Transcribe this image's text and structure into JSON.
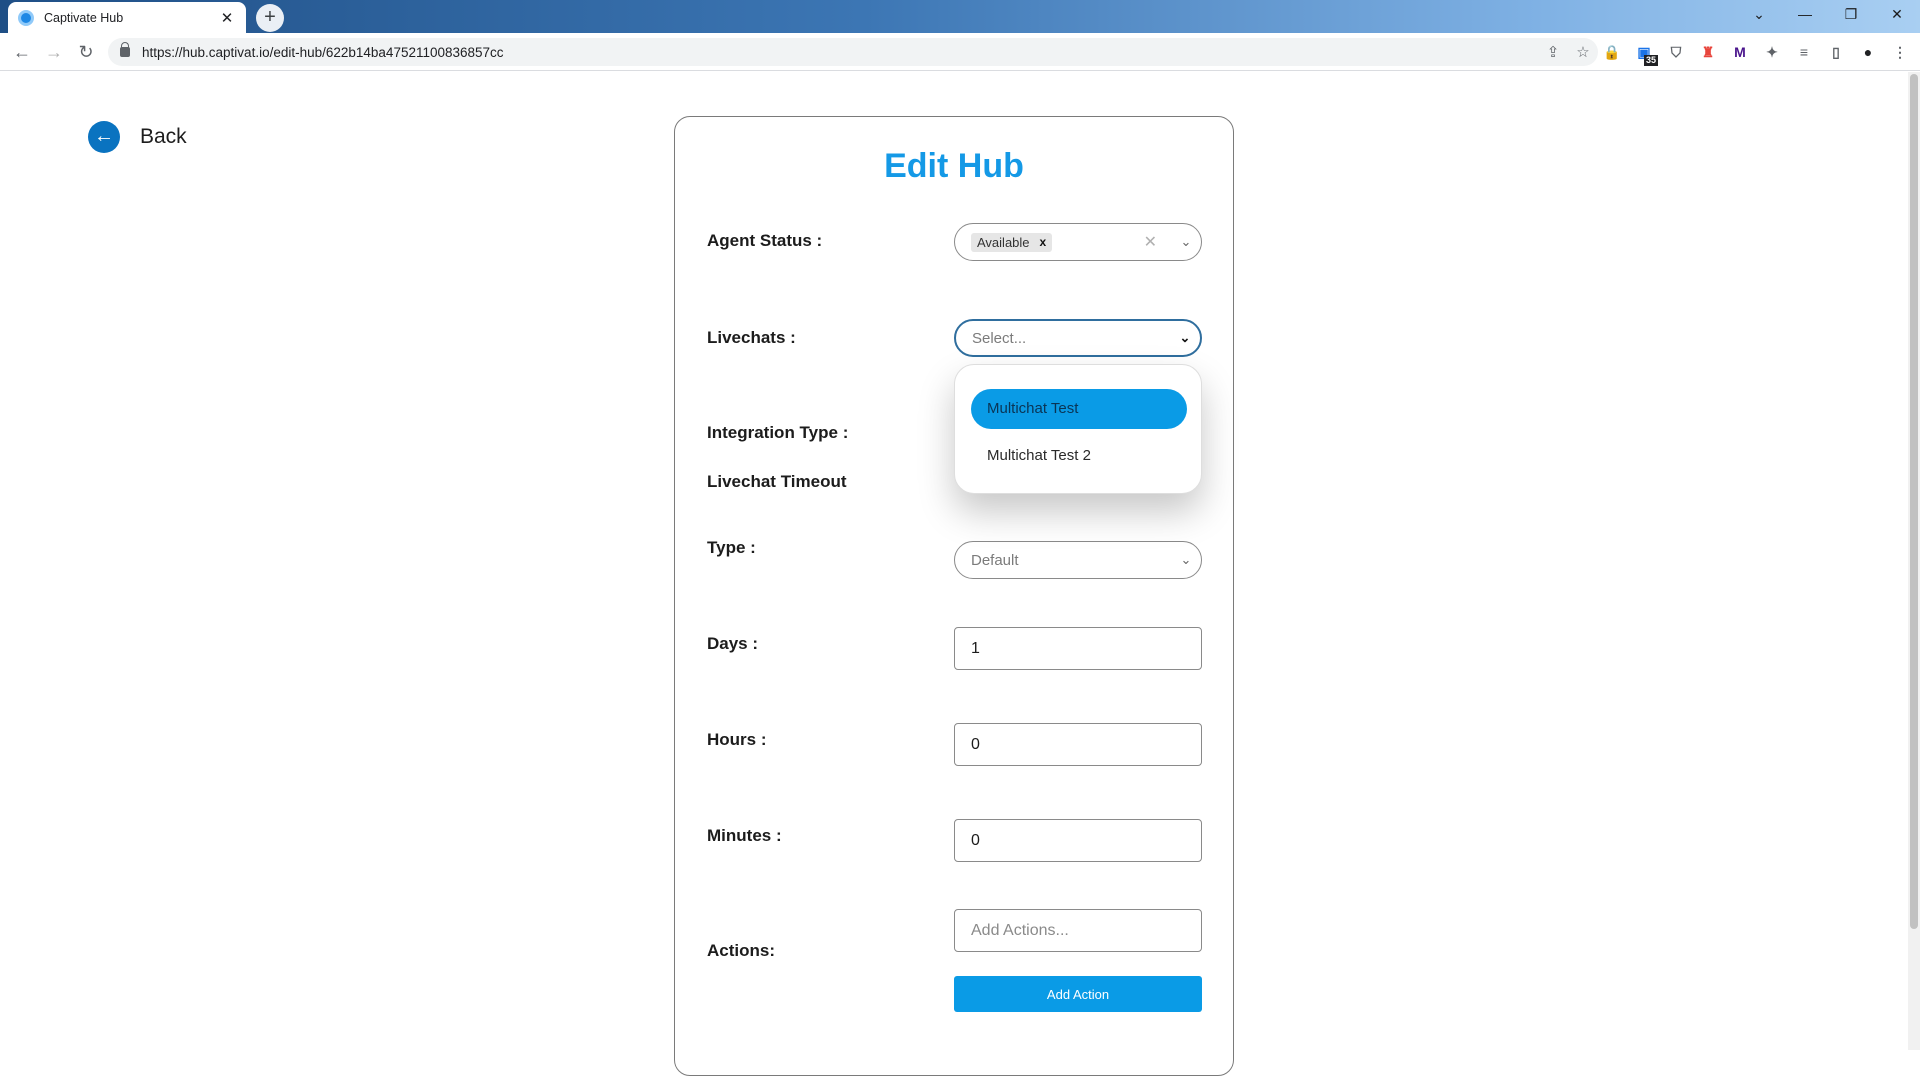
{
  "browser": {
    "tab_title": "Captivate Hub",
    "tab_close": "✕",
    "new_tab": "+",
    "url": "https://hub.captivat.io/edit-hub/622b14ba47521100836857cc",
    "ext_badge": "35",
    "window_controls": {
      "dropdown": "⌄",
      "minimize": "—",
      "restore": "❐",
      "close": "✕"
    },
    "nav": {
      "back": "←",
      "forward": "→",
      "reload": "↻"
    },
    "omni_icons": {
      "share": "⇪",
      "star": "☆"
    },
    "extensions": [
      "🔒",
      "▣",
      "⛉",
      "♜",
      "M",
      "✦",
      "≡",
      "▯",
      "●",
      "⋮"
    ]
  },
  "page": {
    "back_label": "Back",
    "back_icon": "←"
  },
  "form": {
    "title": "Edit Hub",
    "agent_status": {
      "label": "Agent Status :",
      "selected_chip": "Available",
      "chip_remove": "x",
      "clear": "✕",
      "chevron": "⌄"
    },
    "livechats": {
      "label": "Livechats :",
      "placeholder": "Select...",
      "chevron": "⌄",
      "options": [
        "Multichat Test",
        "Multichat Test 2"
      ],
      "highlighted_index": 0
    },
    "integration_type": {
      "label": "Integration Type :"
    },
    "livechat_timeout": {
      "label": "Livechat Timeout"
    },
    "type": {
      "label": "Type :",
      "value": "Default",
      "chevron": "⌄"
    },
    "days": {
      "label": "Days :",
      "value": "1"
    },
    "hours": {
      "label": "Hours :",
      "value": "0"
    },
    "minutes": {
      "label": "Minutes :",
      "value": "0"
    },
    "actions": {
      "label": "Actions:",
      "placeholder": "Add Actions...",
      "button_label": "Add Action"
    }
  },
  "colors": {
    "accent": "#0a9be6",
    "title": "#1499e6",
    "back_icon": "#0a73c0"
  }
}
